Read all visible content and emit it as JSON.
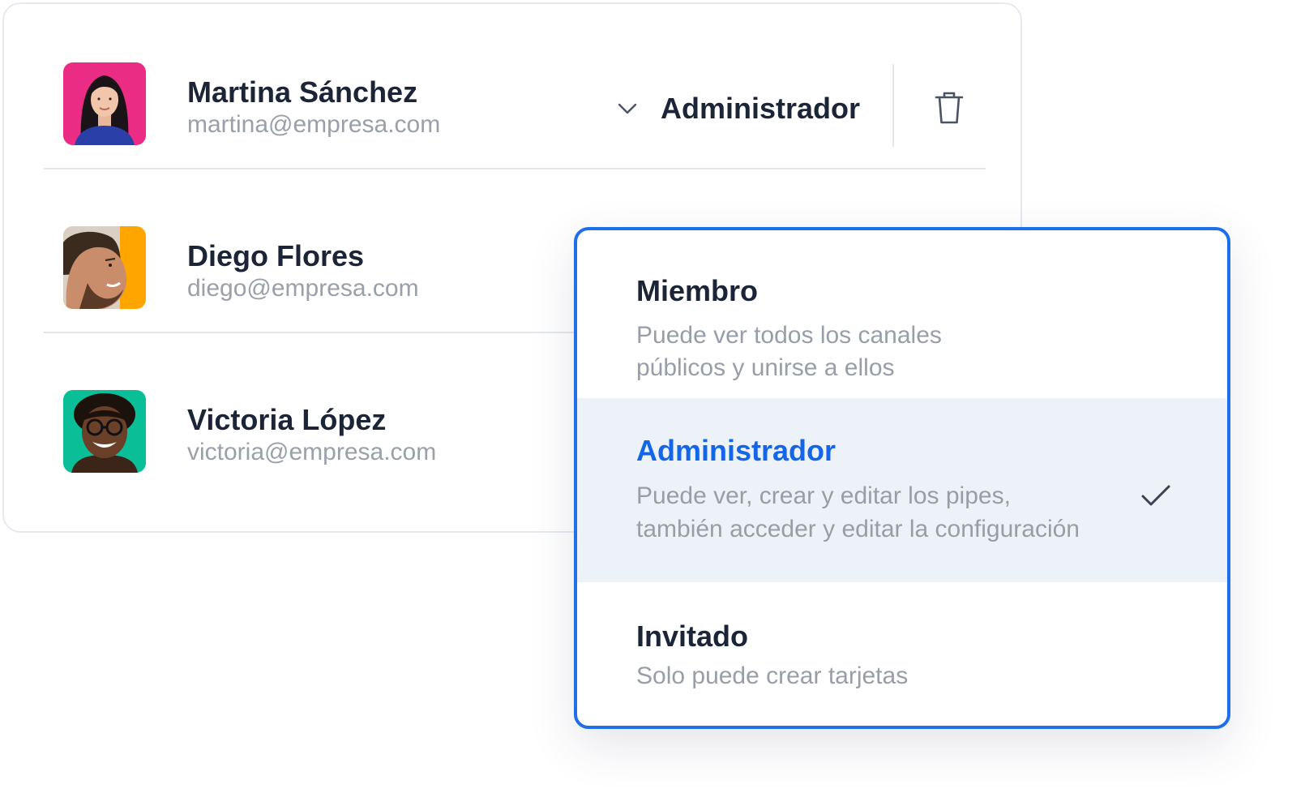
{
  "members": [
    {
      "name": "Martina Sánchez",
      "email": "martina@empresa.com",
      "avatar_bg": "#ea2c85",
      "avatar_icon": "woman-portrait-avatar"
    },
    {
      "name": "Diego Flores",
      "email": "diego@empresa.com",
      "avatar_bg": "#ffa500",
      "avatar_icon": "man-portrait-avatar"
    },
    {
      "name": "Victoria López",
      "email": "victoria@empresa.com",
      "avatar_bg": "#0abf98",
      "avatar_icon": "woman-glasses-portrait-avatar"
    }
  ],
  "role_select": {
    "value": "Administrador",
    "icon": "chevron-down-icon"
  },
  "delete_icon": "trash-icon",
  "role_menu": {
    "options": [
      {
        "title": "Miembro",
        "description_lines": [
          "Puede ver todos los canales",
          "públicos y unirse a ellos"
        ],
        "selected": false
      },
      {
        "title": "Administrador",
        "description_lines": [
          "Puede ver, crear y editar los pipes,",
          "también acceder y editar la configuración"
        ],
        "selected": true
      },
      {
        "title": "Invitado",
        "description_lines": [
          "Solo puede crear tarjetas"
        ],
        "selected": false
      }
    ],
    "selected_icon": "check-icon"
  },
  "colors": {
    "accent": "#1f6fec",
    "selected_text": "#1466e8",
    "selected_bg": "#edf1f8",
    "name_text": "#1b2537",
    "muted_text": "#9aa0aa"
  }
}
